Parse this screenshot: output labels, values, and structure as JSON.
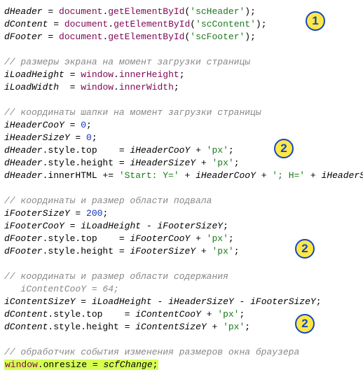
{
  "code": {
    "l1": {
      "a": "dHeader",
      "b": " = ",
      "c": "document",
      "d": ".",
      "e": "getElementById",
      "f": "(",
      "g": "'scHeader'",
      "h": ");"
    },
    "l2": {
      "a": "dContent",
      "b": " = ",
      "c": "document",
      "d": ".",
      "e": "getElementById",
      "f": "(",
      "g": "'scContent'",
      "h": ");"
    },
    "l3": {
      "a": "dFooter",
      "b": " = ",
      "c": "document",
      "d": ".",
      "e": "getElementById",
      "f": "(",
      "g": "'scFooter'",
      "h": ");"
    },
    "c1": "// размеры экрана на момент загрузки страницы",
    "l4": {
      "a": "iLoadHeight",
      "b": " = ",
      "c": "window",
      "d": ".",
      "e": "innerHeight",
      "f": ";"
    },
    "l5": {
      "a": "iLoadWidth",
      "b": "  = ",
      "c": "window",
      "d": ".",
      "e": "innerWidth",
      "f": ";"
    },
    "c2": "// координаты шапки на момент загрузки страницы",
    "l6": {
      "a": "iHeaderCooY",
      "b": " = ",
      "c": "0",
      "d": ";"
    },
    "l7": {
      "a": "iHeaderSizeY",
      "b": " = ",
      "c": "0",
      "d": ";"
    },
    "l8": {
      "a": "dHeader",
      "b": ".style.top    = ",
      "c": "iHeaderCooY",
      "d": " + ",
      "e": "'px'",
      "f": ";"
    },
    "l9": {
      "a": "dHeader",
      "b": ".style.height = ",
      "c": "iHeaderSizeY",
      "d": " + ",
      "e": "'px'",
      "f": ";"
    },
    "l10": {
      "a": "dHeader",
      "b": ".innerHTML += ",
      "c": "'Start: Y='",
      "d": " + ",
      "e": "iHeaderCooY",
      "f": " + ",
      "g": "'; H='",
      "h": " + ",
      "i": "iHeaderSizeY",
      "j": ";"
    },
    "c3": "// координаты и размер области подвала",
    "l11": {
      "a": "iFooterSizeY",
      "b": " = ",
      "c": "200",
      "d": ";"
    },
    "l12": {
      "a": "iFooterCooY",
      "b": " = ",
      "c": "iLoadHeight",
      "d": " - ",
      "e": "iFooterSizeY",
      "f": ";"
    },
    "l13": {
      "a": "dFooter",
      "b": ".style.top    = ",
      "c": "iFooterCooY",
      "d": " + ",
      "e": "'px'",
      "f": ";"
    },
    "l14": {
      "a": "dFooter",
      "b": ".style.height = ",
      "c": "iFooterSizeY",
      "d": " + ",
      "e": "'px'",
      "f": ";"
    },
    "c4": "// координаты и размер области содержания",
    "c4b": "   iContentCooY = 64;",
    "l15": {
      "a": "iContentSizeY",
      "b": " = ",
      "c": "iLoadHeight",
      "d": " - ",
      "e": "iHeaderSizeY",
      "f": " - ",
      "g": "iFooterSizeY",
      "h": ";"
    },
    "l16": {
      "a": "dContent",
      "b": ".style.top    = ",
      "c": "iContentCooY",
      "d": " + ",
      "e": "'px'",
      "f": ";"
    },
    "l17": {
      "a": "dContent",
      "b": ".style.height = ",
      "c": "iContentSizeY",
      "d": " + ",
      "e": "'px'",
      "f": ";"
    },
    "c5": "// обработчик события изменения размеров окна браузера",
    "l18": {
      "a": "window",
      "b": ".onresize = ",
      "c": "scfChange",
      "d": ";"
    }
  },
  "badges": {
    "b1": "1",
    "b2": "2",
    "b3": "2",
    "b4": "2"
  }
}
